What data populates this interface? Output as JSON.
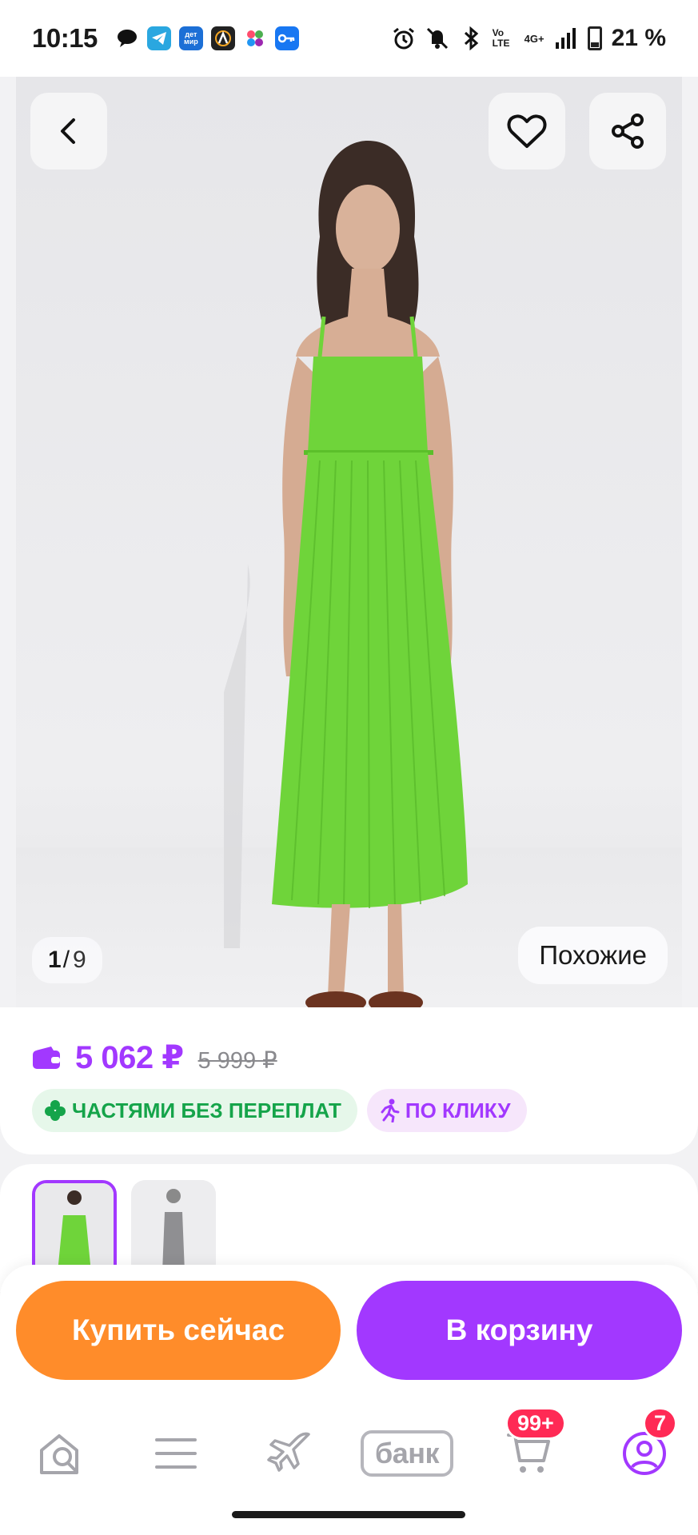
{
  "status_bar": {
    "time": "10:15",
    "battery": "21 %",
    "network_label": "4G+",
    "volte_label": "Vo LTE",
    "notification_icons": [
      "messages-icon",
      "telegram-icon",
      "detmir-icon",
      "app-a-icon",
      "dots-icon",
      "key-icon"
    ],
    "detmir_label": "дет мир"
  },
  "product": {
    "image_index": "1",
    "image_total": "9",
    "image_separator": "/",
    "similar_label": "Похожие",
    "price": "5 062 ₽",
    "old_price": "5 999 ₽"
  },
  "badges": {
    "installments": "ЧАСТЯМИ БЕЗ ПЕРЕПЛАТ",
    "one_click": "ПО КЛИКУ"
  },
  "actions": {
    "buy_now": "Купить сейчас",
    "add_to_cart": "В корзину"
  },
  "nav": {
    "bank_label": "банк",
    "cart_badge": "99+",
    "profile_badge": "7"
  },
  "colors": {
    "accent_purple": "#a238ff",
    "buy_orange": "#ff8c2a",
    "badge_red": "#ff2a55",
    "dress_green": "#6fd43a",
    "installment_green": "#15a44a"
  }
}
